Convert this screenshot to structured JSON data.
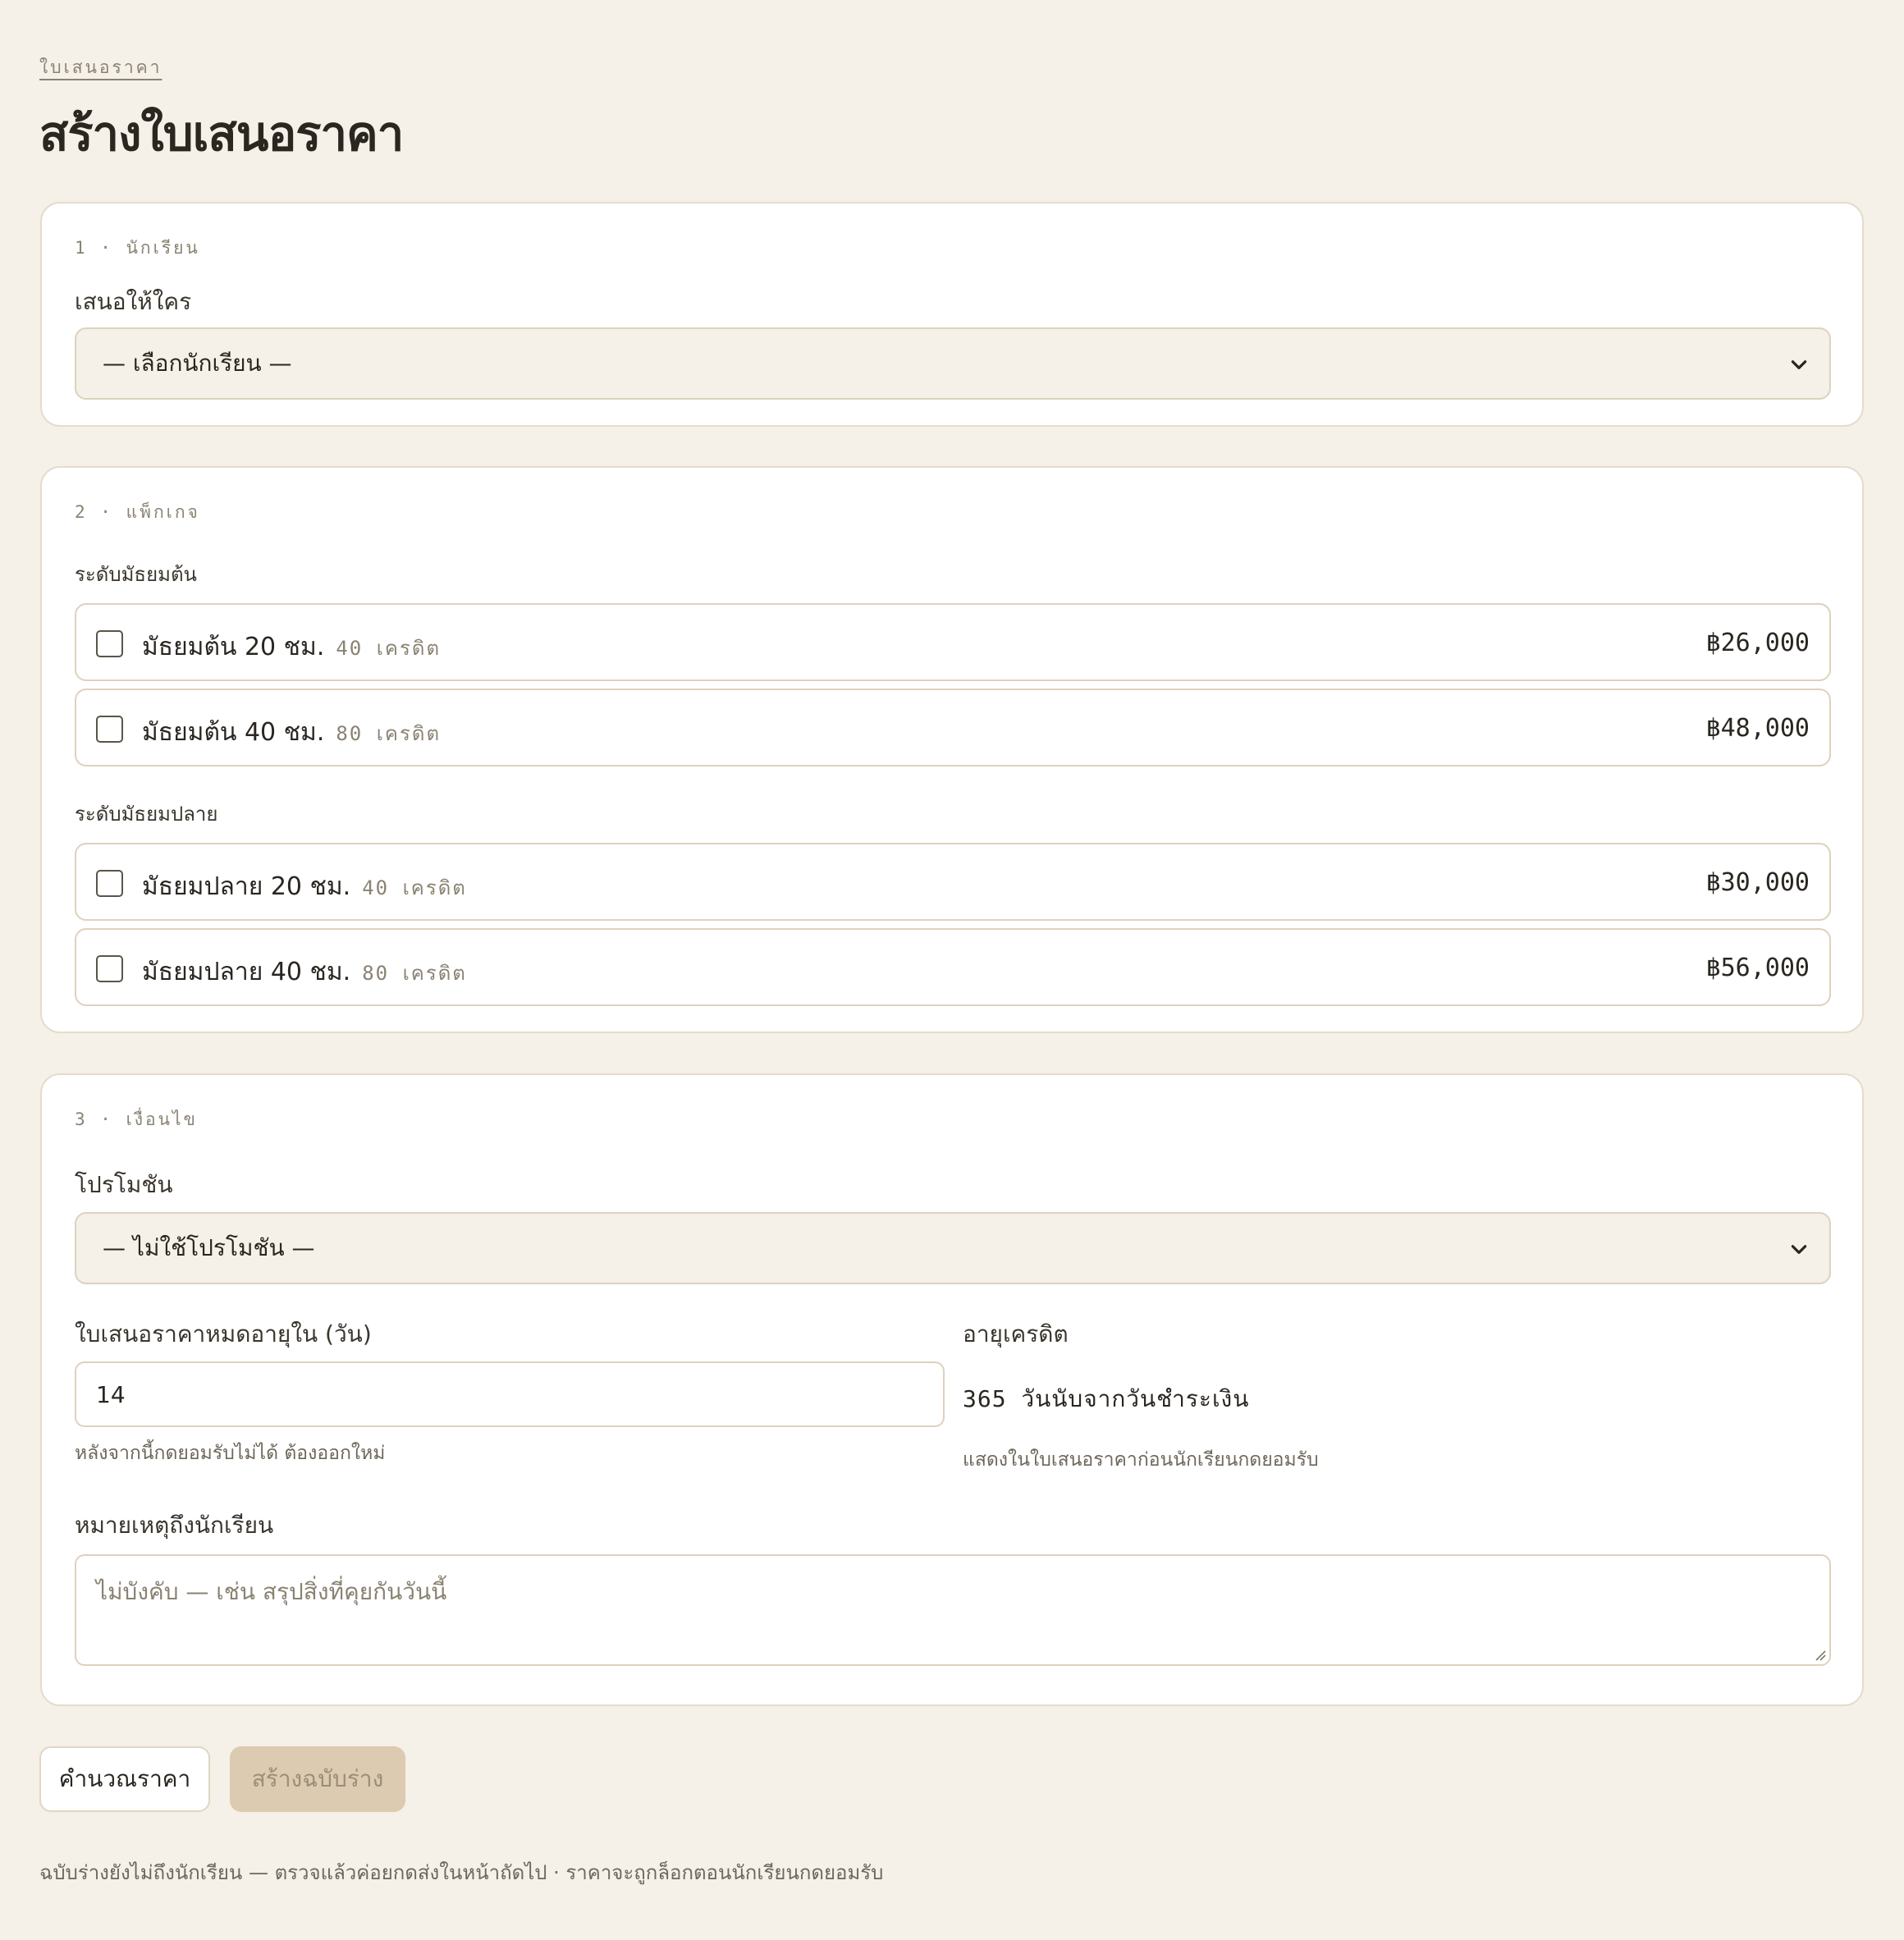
{
  "breadcrumb": "ใบเสนอราคา",
  "title": "สร้างใบเสนอราคา",
  "student_section": {
    "step": "1 · นักเรียน",
    "label": "เสนอให้ใคร",
    "select_value": "— เลือกนักเรียน —"
  },
  "package_section": {
    "step": "2 · แพ็กเกจ",
    "groups": [
      {
        "label": "ระดับมัธยมต้น",
        "items": [
          {
            "name": "มัธยมต้น 20 ชม.",
            "credits": "40 เครดิต",
            "price": "฿26,000",
            "checked": false
          },
          {
            "name": "มัธยมต้น 40 ชม.",
            "credits": "80 เครดิต",
            "price": "฿48,000",
            "checked": false
          }
        ]
      },
      {
        "label": "ระดับมัธยมปลาย",
        "items": [
          {
            "name": "มัธยมปลาย 20 ชม.",
            "credits": "40 เครดิต",
            "price": "฿30,000",
            "checked": false
          },
          {
            "name": "มัธยมปลาย 40 ชม.",
            "credits": "80 เครดิต",
            "price": "฿56,000",
            "checked": false
          }
        ]
      }
    ]
  },
  "conditions_section": {
    "step": "3 · เงื่อนไข",
    "promo_label": "โปรโมชัน",
    "promo_value": "— ไม่ใช้โปรโมชัน —",
    "expiry_label": "ใบเสนอราคาหมดอายุใน (วัน)",
    "expiry_value": "14",
    "expiry_hint": "หลังจากนี้กดยอมรับไม่ได้ ต้องออกใหม่",
    "credit_age_label": "อายุเครดิต",
    "credit_age_value": "365 วันนับจากวันชำระเงิน",
    "credit_age_hint": "แสดงในใบเสนอราคาก่อนนักเรียนกดยอมรับ",
    "note_label": "หมายเหตุถึงนักเรียน",
    "note_placeholder": "ไม่บังคับ — เช่น สรุปสิ่งที่คุยกันวันนี้"
  },
  "actions": {
    "calculate_label": "คำนวณราคา",
    "create_draft_label": "สร้างฉบับร่าง"
  },
  "footnote": "ฉบับร่างยังไม่ถึงนักเรียน — ตรวจแล้วค่อยกดส่งในหน้าถัดไป · ราคาจะถูกล็อกตอนนักเรียนกดยอมรับ",
  "icons": {
    "select_chevron": "chevron-down-icon",
    "checkbox": "checkbox-unchecked"
  },
  "colors": {
    "background": "#f5f0e8",
    "card": "#ffffff",
    "border": "#ddd2bc",
    "primary_disabled": "#dccbb0",
    "text": "#2a2620",
    "muted": "#8a8272"
  }
}
